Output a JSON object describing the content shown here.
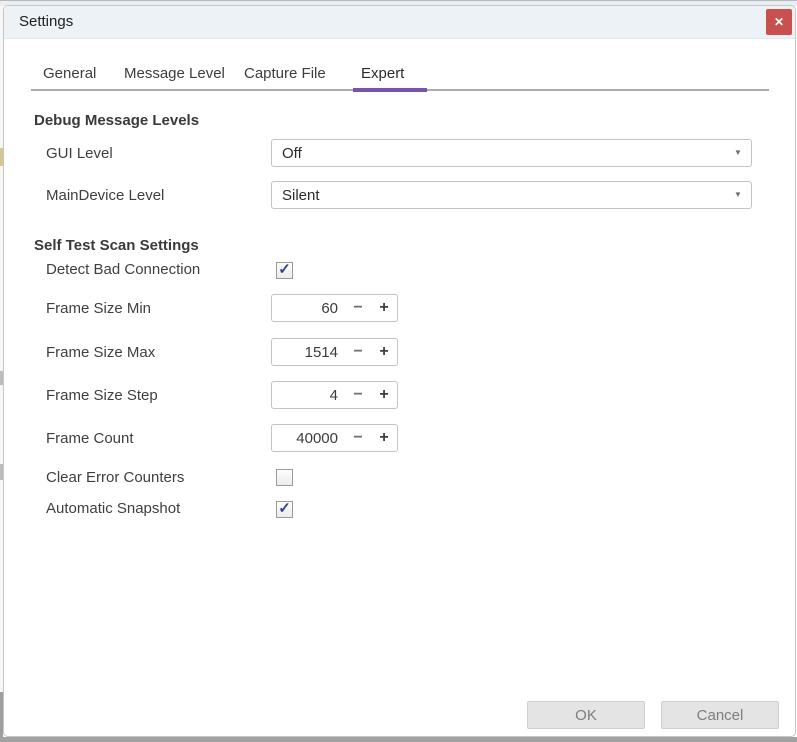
{
  "window": {
    "title": "Settings",
    "close_glyph": "✕"
  },
  "tabs": [
    {
      "label": "General",
      "active": false
    },
    {
      "label": "Message Level",
      "active": false
    },
    {
      "label": "Capture File",
      "active": false
    },
    {
      "label": "Expert",
      "active": true
    }
  ],
  "debug": {
    "heading": "Debug Message Levels",
    "rows": [
      {
        "label": "GUI Level",
        "control": "dropdown",
        "value": "Off"
      },
      {
        "label": "MainDevice Level",
        "control": "dropdown",
        "value": "Silent"
      }
    ]
  },
  "selftest": {
    "heading": "Self Test Scan Settings",
    "rows": [
      {
        "label": "Detect Bad Connection",
        "control": "checkbox",
        "checked": true
      },
      {
        "label": "Frame Size Min",
        "control": "spinner",
        "value": "60"
      },
      {
        "label": "Frame Size Max",
        "control": "spinner",
        "value": "1514"
      },
      {
        "label": "Frame Size Step",
        "control": "spinner",
        "value": "4"
      },
      {
        "label": "Frame Count",
        "control": "spinner",
        "value": "40000"
      },
      {
        "label": "Clear Error Counters",
        "control": "checkbox",
        "checked": false
      },
      {
        "label": "Automatic Snapshot",
        "control": "checkbox",
        "checked": true
      }
    ]
  },
  "footer": {
    "ok_label": "OK",
    "cancel_label": "Cancel"
  },
  "icons": {
    "minus": "−",
    "plus": "+",
    "check": "✓",
    "dropdown_arrow": "▼"
  },
  "colors": {
    "accent": "#7b52ab",
    "close_button": "#c85150",
    "checkmark": "#34418f"
  }
}
